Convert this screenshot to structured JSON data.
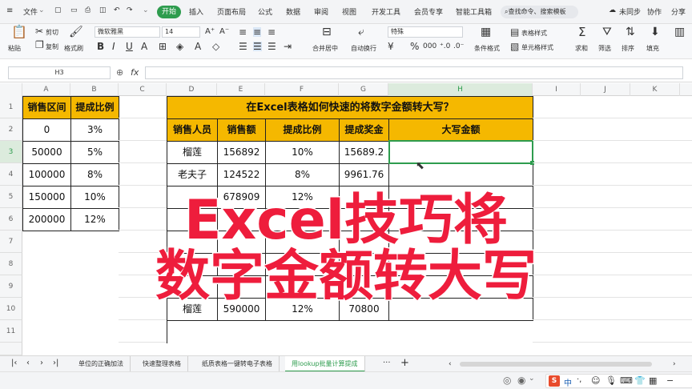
{
  "menubar": {
    "file": "文件",
    "tabs": [
      "开始",
      "插入",
      "页面布局",
      "公式",
      "数据",
      "审阅",
      "视图",
      "开发工具",
      "会员专享",
      "智能工具箱"
    ],
    "search_placeholder": "查找命令、搜索模板",
    "sync": "未同步",
    "collab": "协作",
    "share": "分享"
  },
  "ribbon": {
    "paste": "粘贴",
    "cut": "剪切",
    "copy": "复制",
    "format_painter": "格式刷",
    "font_name": "微软雅黑",
    "font_size": "14",
    "number_format": "特殊",
    "merge_center": "合并居中",
    "wrap": "自动换行",
    "table_style": "表格样式",
    "cond_format": "条件格式",
    "cell_style": "单元格样式",
    "sum": "求和",
    "filter": "筛选",
    "sort": "排序",
    "fill": "填充"
  },
  "formula_bar": {
    "name_box": "H3",
    "formula": ""
  },
  "columns": [
    "A",
    "B",
    "C",
    "D",
    "E",
    "F",
    "G",
    "H",
    "I",
    "J",
    "K"
  ],
  "rows": [
    "1",
    "2",
    "3",
    "4",
    "5",
    "6",
    "7",
    "8",
    "9",
    "10",
    "11"
  ],
  "lookup_table": {
    "headers": [
      "销售区间",
      "提成比例"
    ],
    "rows": [
      [
        "0",
        "3%"
      ],
      [
        "50000",
        "5%"
      ],
      [
        "100000",
        "8%"
      ],
      [
        "150000",
        "10%"
      ],
      [
        "200000",
        "12%"
      ]
    ]
  },
  "main_table": {
    "title": "在Excel表格如何快速的将数字金额转大写？",
    "headers": [
      "销售人员",
      "销售额",
      "提成比例",
      "提成奖金",
      "大写金额"
    ],
    "rows": [
      [
        "榴莲",
        "156892",
        "10%",
        "15689.2",
        ""
      ],
      [
        "老夫子",
        "124522",
        "8%",
        "9961.76",
        ""
      ],
      [
        "",
        "678909",
        "12%",
        "",
        ""
      ],
      [
        "",
        "",
        "",
        "",
        ""
      ],
      [
        "",
        "",
        "",
        "",
        ""
      ],
      [
        "",
        "",
        "",
        "",
        ""
      ],
      [
        "",
        "",
        "",
        "",
        ""
      ],
      [
        "榴莲",
        "590000",
        "12%",
        "70800",
        ""
      ]
    ]
  },
  "overlay": {
    "line1": "Excel技巧将",
    "line2": "数字金额转大写"
  },
  "sheets": [
    "单位的正确加法",
    "快速整理表格",
    "纸质表格一键转电子表格",
    "用lookup批量计算提成"
  ],
  "status": {
    "ime": "中"
  },
  "colors": {
    "header_fill": "#f5b800",
    "accent": "#2e9c4e",
    "overlay_text": "#ee1d3c",
    "selection": "#2e9c4e"
  }
}
